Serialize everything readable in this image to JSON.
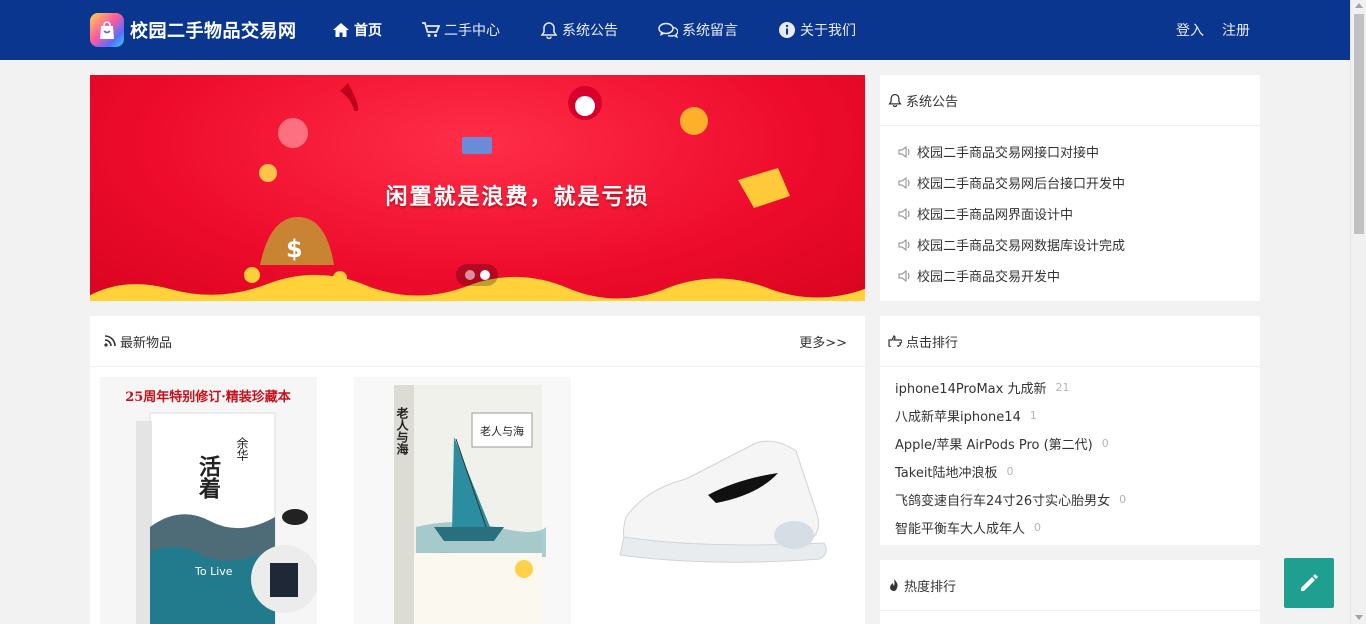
{
  "brand": {
    "title": "校园二手物品交易网"
  },
  "nav": {
    "items": [
      {
        "label": "首页",
        "icon": "home-icon",
        "active": true
      },
      {
        "label": "二手中心",
        "icon": "cart-icon"
      },
      {
        "label": "系统公告",
        "icon": "bell-icon"
      },
      {
        "label": "系统留言",
        "icon": "comments-icon"
      },
      {
        "label": "关于我们",
        "icon": "info-icon"
      }
    ]
  },
  "auth": {
    "login": "登入",
    "register": "注册"
  },
  "banner": {
    "slogan": "闲置就是浪费，就是亏损",
    "slides": 2,
    "active_slide": 2
  },
  "notice": {
    "title": "系统公告",
    "items": [
      "校园二手商品交易网接口对接中",
      "校园二手商品交易网后台接口开发中",
      "校园二手商品网界面设计中",
      "校园二手商品交易网数据库设计完成",
      "校园二手商品交易开发中"
    ]
  },
  "latest": {
    "title": "最新物品",
    "more": "更多>>",
    "goods": [
      {
        "cover_top": "25周年特别修订·精装珍藏本",
        "cover_title": "活着",
        "cover_author": "余华",
        "cover_en": "To Live"
      },
      {
        "cover_title": "老人与海",
        "cover_label": "老人与海"
      },
      {
        "name": "白色运动鞋"
      }
    ]
  },
  "rank": {
    "title": "点击排行",
    "items": [
      {
        "name": "iphone14ProMax 九成新",
        "count": "21"
      },
      {
        "name": "八成新苹果iphone14",
        "count": "1"
      },
      {
        "name": "Apple/苹果 AirPods Pro (第二代)",
        "count": "0"
      },
      {
        "name": "Takeit陆地冲浪板",
        "count": "0"
      },
      {
        "name": "飞鸽变速自行车24寸26寸实心胎男女",
        "count": "0"
      },
      {
        "name": "智能平衡车大人成年人",
        "count": "0"
      }
    ]
  },
  "hot": {
    "title": "热度排行"
  },
  "colors": {
    "navbar": "#0a3690",
    "banner": "#ee0b2c",
    "fab": "#1e9f8f"
  }
}
